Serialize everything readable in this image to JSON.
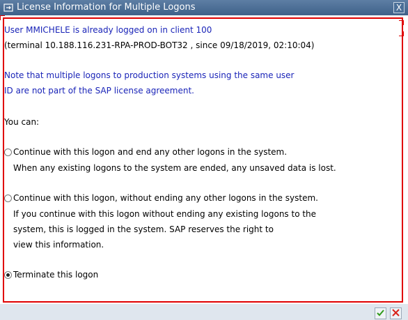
{
  "window": {
    "title": "License Information for Multiple Logons",
    "close_label": "X"
  },
  "message": {
    "line1": "User MMICHELE is already logged on in client 100",
    "line2": "(terminal 10.188.116.231-RPA-PROD-BOT32 , since 09/18/2019, 02:10:04)",
    "note1": "Note that multiple logons to production systems using the same user",
    "note2": "ID are not part of the SAP license agreement.",
    "you_can": "You can:"
  },
  "options": [
    {
      "label": "Continue with this logon and end any other logons in the system.",
      "desc1": "When any existing logons to the system are ended, any unsaved data is lost.",
      "selected": false
    },
    {
      "label": "Continue with this logon, without ending any other logons in the system.",
      "desc1": "If you continue with this logon without ending any existing logons to the",
      "desc2": "system, this is logged in the system. SAP reserves the right to",
      "desc3": "view this information.",
      "selected": false
    },
    {
      "label": "Terminate this logon",
      "selected": true
    }
  ],
  "buttons": {
    "ok_icon": "checkmark-icon",
    "cancel_icon": "cancel-x-icon"
  },
  "colors": {
    "titlebar": "#3f6189",
    "info_text": "#1a24b8",
    "highlight_border": "#e00000",
    "ok": "#2f9a1a",
    "cancel": "#d8231a"
  }
}
